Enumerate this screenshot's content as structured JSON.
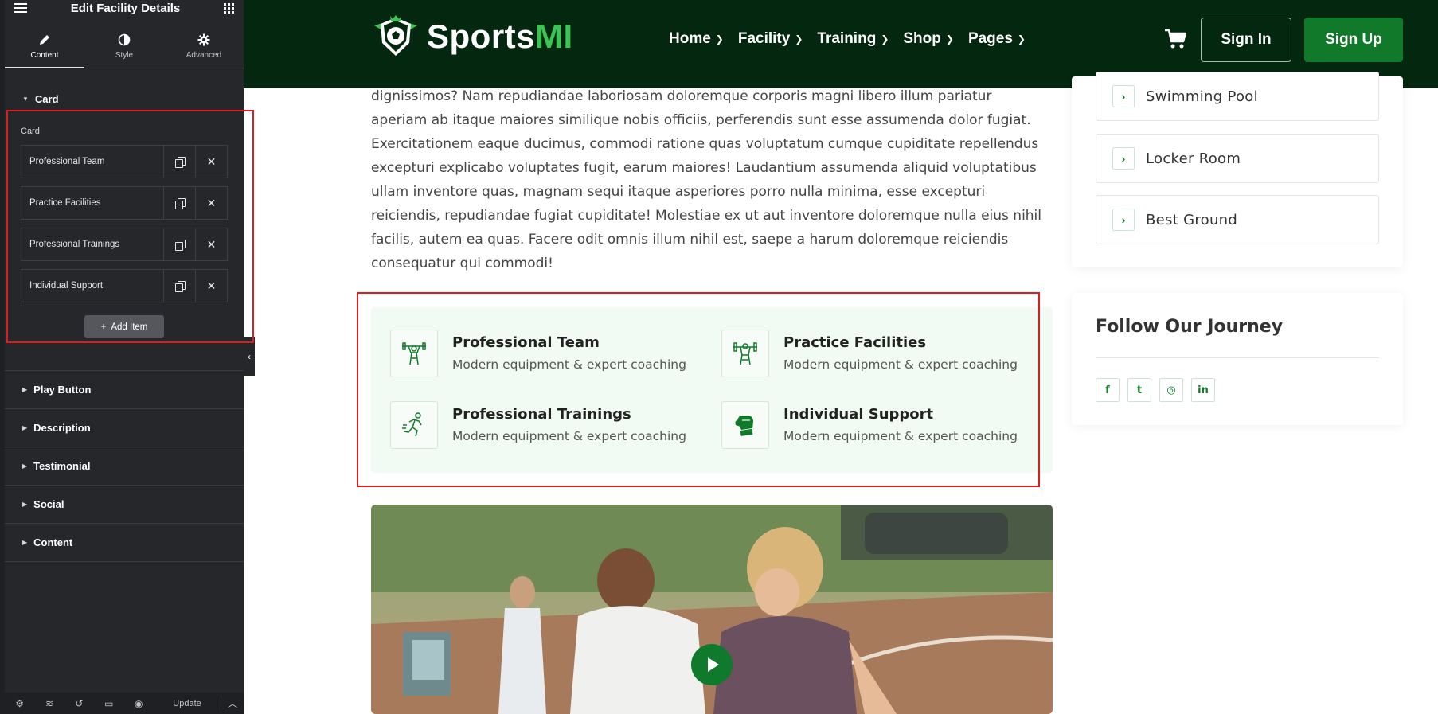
{
  "editor": {
    "title": "Edit Facility Details",
    "tabs": [
      {
        "label": "Content",
        "icon": "pencil-icon"
      },
      {
        "label": "Style",
        "icon": "contrast-icon"
      },
      {
        "label": "Advanced",
        "icon": "gear-icon"
      }
    ],
    "card_section": {
      "heading": "Card",
      "field_label": "Card",
      "items": [
        {
          "label": "Professional Team"
        },
        {
          "label": "Practice Facilities"
        },
        {
          "label": "Professional Trainings"
        },
        {
          "label": "Individual Support"
        }
      ],
      "add_item_label": "Add Item"
    },
    "sections": [
      "Play Button",
      "Description",
      "Testimonial",
      "Social",
      "Content"
    ],
    "footer": {
      "icons": [
        "settings-icon",
        "layers-icon",
        "history-icon",
        "responsive-icon",
        "preview-icon"
      ],
      "update_label": "Update"
    }
  },
  "site": {
    "brand": {
      "prefix": "Sports",
      "suffix": "MI"
    },
    "nav": [
      {
        "label": "Home"
      },
      {
        "label": "Facility"
      },
      {
        "label": "Training"
      },
      {
        "label": "Shop"
      },
      {
        "label": "Pages"
      }
    ],
    "sign_in": "Sign In",
    "sign_up": "Sign Up",
    "paragraph": "dignissimos? Nam repudiandae laboriosam doloremque corporis magni libero illum pariatur aperiam ab itaque maiores similique nobis officiis, perferendis sunt esse assumenda dolor fugiat. Exercitationem eaque ducimus, commodi ratione quas voluptatum cumque cupiditate repellendus excepturi explicabo voluptates fugit, earum maiores! Laudantium assumenda aliquid voluptatibus ullam inventore quas, magnam sequi itaque asperiores porro nulla minima, esse excepturi reiciendis, repudiandae fugiat cupiditate! Molestiae ex ut aut inventore doloremque nulla eius nihil facilis, autem ea quas. Facere odit omnis illum nihil est, saepe a harum doloremque reiciendis consequatur qui commodi!",
    "features": [
      {
        "title": "Professional Team",
        "subtitle": "Modern equipment & expert coaching",
        "icon": "weightlifter-icon"
      },
      {
        "title": "Practice Facilities",
        "subtitle": "Modern equipment & expert coaching",
        "icon": "weightlifter-icon"
      },
      {
        "title": "Professional Trainings",
        "subtitle": "Modern equipment & expert coaching",
        "icon": "runner-icon"
      },
      {
        "title": "Individual Support",
        "subtitle": "Modern equipment & expert coaching",
        "icon": "boxing-glove-icon"
      }
    ],
    "sidebar": {
      "facilities": [
        {
          "name": "Swimming Pool"
        },
        {
          "name": "Locker Room"
        },
        {
          "name": "Best Ground"
        }
      ],
      "follow_title": "Follow Our Journey",
      "social": [
        {
          "icon": "facebook-icon",
          "glyph": "f"
        },
        {
          "icon": "twitter-icon",
          "glyph": "t"
        },
        {
          "icon": "instagram-icon",
          "glyph": "◎"
        },
        {
          "icon": "linkedin-icon",
          "glyph": "in"
        }
      ]
    },
    "colors": {
      "header_bg": "#03280f",
      "brand_green": "#107a2a",
      "accent_green": "#3cc454",
      "feature_bg": "#f1faf3"
    }
  }
}
